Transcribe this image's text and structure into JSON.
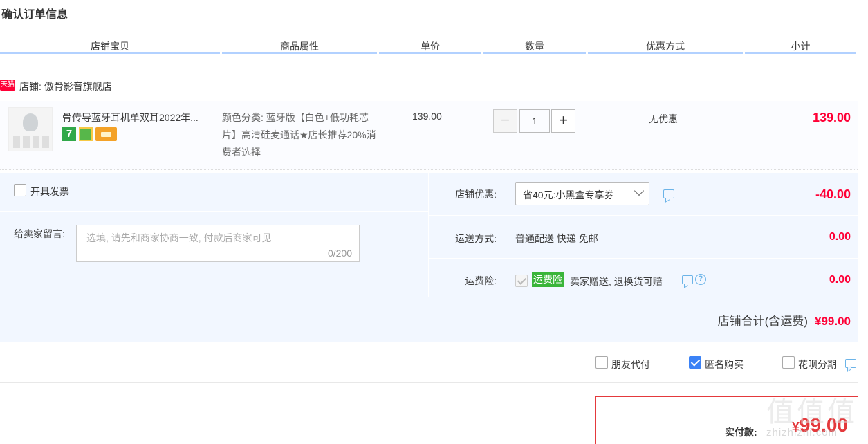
{
  "page_title": "确认订单信息",
  "columns": [
    "店铺宝贝",
    "商品属性",
    "单价",
    "数量",
    "优惠方式",
    "小计"
  ],
  "shop": {
    "badge": "天猫",
    "label": "店铺: 傲骨影音旗舰店"
  },
  "item": {
    "title": "骨传导蓝牙耳机单双耳2022年...",
    "badge_7": "7",
    "sku": "颜色分类: 蓝牙版【白色+低功耗芯片】高清硅麦通话★店长推荐20%消费者选择",
    "unit_price": "139.00",
    "quantity": "1",
    "minus": "−",
    "plus": "+",
    "discount": "无优惠",
    "subtotal": "139.00"
  },
  "invoice_label": "开具发票",
  "memo": {
    "label": "给卖家留言:",
    "placeholder": "选填, 请先和商家协商一致, 付款后商家可见",
    "count": "0/200"
  },
  "shop_coupon": {
    "label": "店铺优惠:",
    "selected": "省40元:小黑盒专享券",
    "amount": "-40.00"
  },
  "shipping": {
    "label": "运送方式:",
    "value": "普通配送 快递 免邮",
    "amount": "0.00"
  },
  "insurance": {
    "label": "运费险:",
    "tag": "运费险",
    "text": "卖家赠送, 退换货可赔",
    "amount": "0.00"
  },
  "shop_total": {
    "label": "店铺合计(含运费)",
    "value": "¥99.00"
  },
  "options": [
    {
      "label": "朋友代付",
      "checked": false
    },
    {
      "label": "匿名购买",
      "checked": true
    },
    {
      "label": "花呗分期",
      "checked": false
    }
  ],
  "payment": {
    "label": "实付款:",
    "currency": "¥",
    "value": "99.00"
  },
  "watermark": {
    "glyphs": [
      "值",
      "值",
      "值"
    ],
    "url": "zhizhizhi.com"
  },
  "colors": {
    "accent_red": "#ff0036",
    "header_line": "#b2d1ff",
    "panel_bg": "#f2f7ff",
    "check_blue": "#3b82f6"
  }
}
